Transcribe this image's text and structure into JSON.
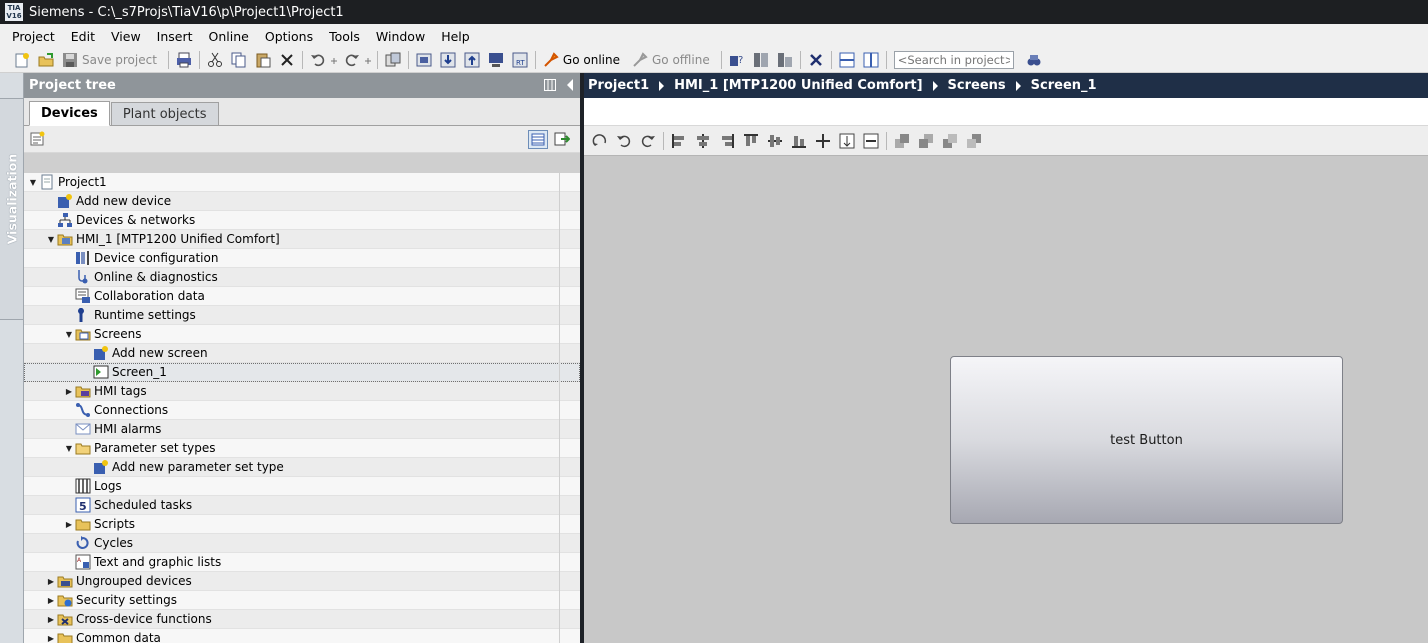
{
  "app": {
    "logo_text": "TIA V16",
    "title": "Siemens  -  C:\\_s7Projs\\TiaV16\\p\\Project1\\Project1"
  },
  "menu": [
    "Project",
    "Edit",
    "View",
    "Insert",
    "Online",
    "Options",
    "Tools",
    "Window",
    "Help"
  ],
  "toolbar": {
    "save_label": "Save project",
    "go_online_label": "Go online",
    "go_offline_label": "Go offline",
    "search_placeholder": "<Search in project>"
  },
  "side_strip": {
    "label": "Visualization"
  },
  "project_tree": {
    "title": "Project tree",
    "tabs": [
      {
        "label": "Devices",
        "active": true
      },
      {
        "label": "Plant objects",
        "active": false
      }
    ],
    "items": [
      {
        "label": "Project1",
        "level": 0,
        "expander": "expanded",
        "icon": "project-icon"
      },
      {
        "label": "Add new device",
        "level": 1,
        "expander": "none",
        "icon": "add-device-icon"
      },
      {
        "label": "Devices & networks",
        "level": 1,
        "expander": "none",
        "icon": "network-icon"
      },
      {
        "label": "HMI_1 [MTP1200 Unified Comfort]",
        "level": 1,
        "expander": "expanded",
        "icon": "hmi-device-icon"
      },
      {
        "label": "Device configuration",
        "level": 2,
        "expander": "none",
        "icon": "device-config-icon"
      },
      {
        "label": "Online & diagnostics",
        "level": 2,
        "expander": "none",
        "icon": "diagnostics-icon"
      },
      {
        "label": "Collaboration data",
        "level": 2,
        "expander": "none",
        "icon": "collaboration-icon"
      },
      {
        "label": "Runtime settings",
        "level": 2,
        "expander": "none",
        "icon": "runtime-settings-icon"
      },
      {
        "label": "Screens",
        "level": 2,
        "expander": "expanded",
        "icon": "screens-folder-icon"
      },
      {
        "label": "Add new screen",
        "level": 3,
        "expander": "none",
        "icon": "add-screen-icon"
      },
      {
        "label": "Screen_1",
        "level": 3,
        "expander": "none",
        "icon": "screen-icon",
        "selected": true
      },
      {
        "label": "HMI tags",
        "level": 2,
        "expander": "collapsed",
        "icon": "hmi-tags-icon"
      },
      {
        "label": "Connections",
        "level": 2,
        "expander": "none",
        "icon": "connections-icon"
      },
      {
        "label": "HMI alarms",
        "level": 2,
        "expander": "none",
        "icon": "alarms-icon"
      },
      {
        "label": "Parameter set types",
        "level": 2,
        "expander": "expanded",
        "icon": "folder-icon"
      },
      {
        "label": "Add new parameter set type",
        "level": 3,
        "expander": "none",
        "icon": "add-parameter-set-icon"
      },
      {
        "label": "Logs",
        "level": 2,
        "expander": "none",
        "icon": "logs-icon"
      },
      {
        "label": "Scheduled tasks",
        "level": 2,
        "expander": "none",
        "icon": "scheduled-tasks-icon"
      },
      {
        "label": "Scripts",
        "level": 2,
        "expander": "collapsed",
        "icon": "scripts-icon"
      },
      {
        "label": "Cycles",
        "level": 2,
        "expander": "none",
        "icon": "cycles-icon"
      },
      {
        "label": "Text and graphic lists",
        "level": 2,
        "expander": "none",
        "icon": "text-lists-icon"
      },
      {
        "label": "Ungrouped devices",
        "level": 1,
        "expander": "collapsed",
        "icon": "ungrouped-devices-icon"
      },
      {
        "label": "Security settings",
        "level": 1,
        "expander": "collapsed",
        "icon": "security-icon"
      },
      {
        "label": "Cross-device functions",
        "level": 1,
        "expander": "collapsed",
        "icon": "cross-device-icon"
      },
      {
        "label": "Common data",
        "level": 1,
        "expander": "collapsed",
        "icon": "common-data-icon"
      }
    ]
  },
  "editor": {
    "breadcrumb": [
      "Project1",
      "HMI_1 [MTP1200 Unified Comfort]",
      "Screens",
      "Screen_1"
    ],
    "canvas_button_label": "test Button"
  },
  "colors": {
    "titlebar": "#1d1f22",
    "breadcrumb_bg": "#1f2f47",
    "tree_header": "#8f959a",
    "canvas": "#c8c8c8"
  }
}
